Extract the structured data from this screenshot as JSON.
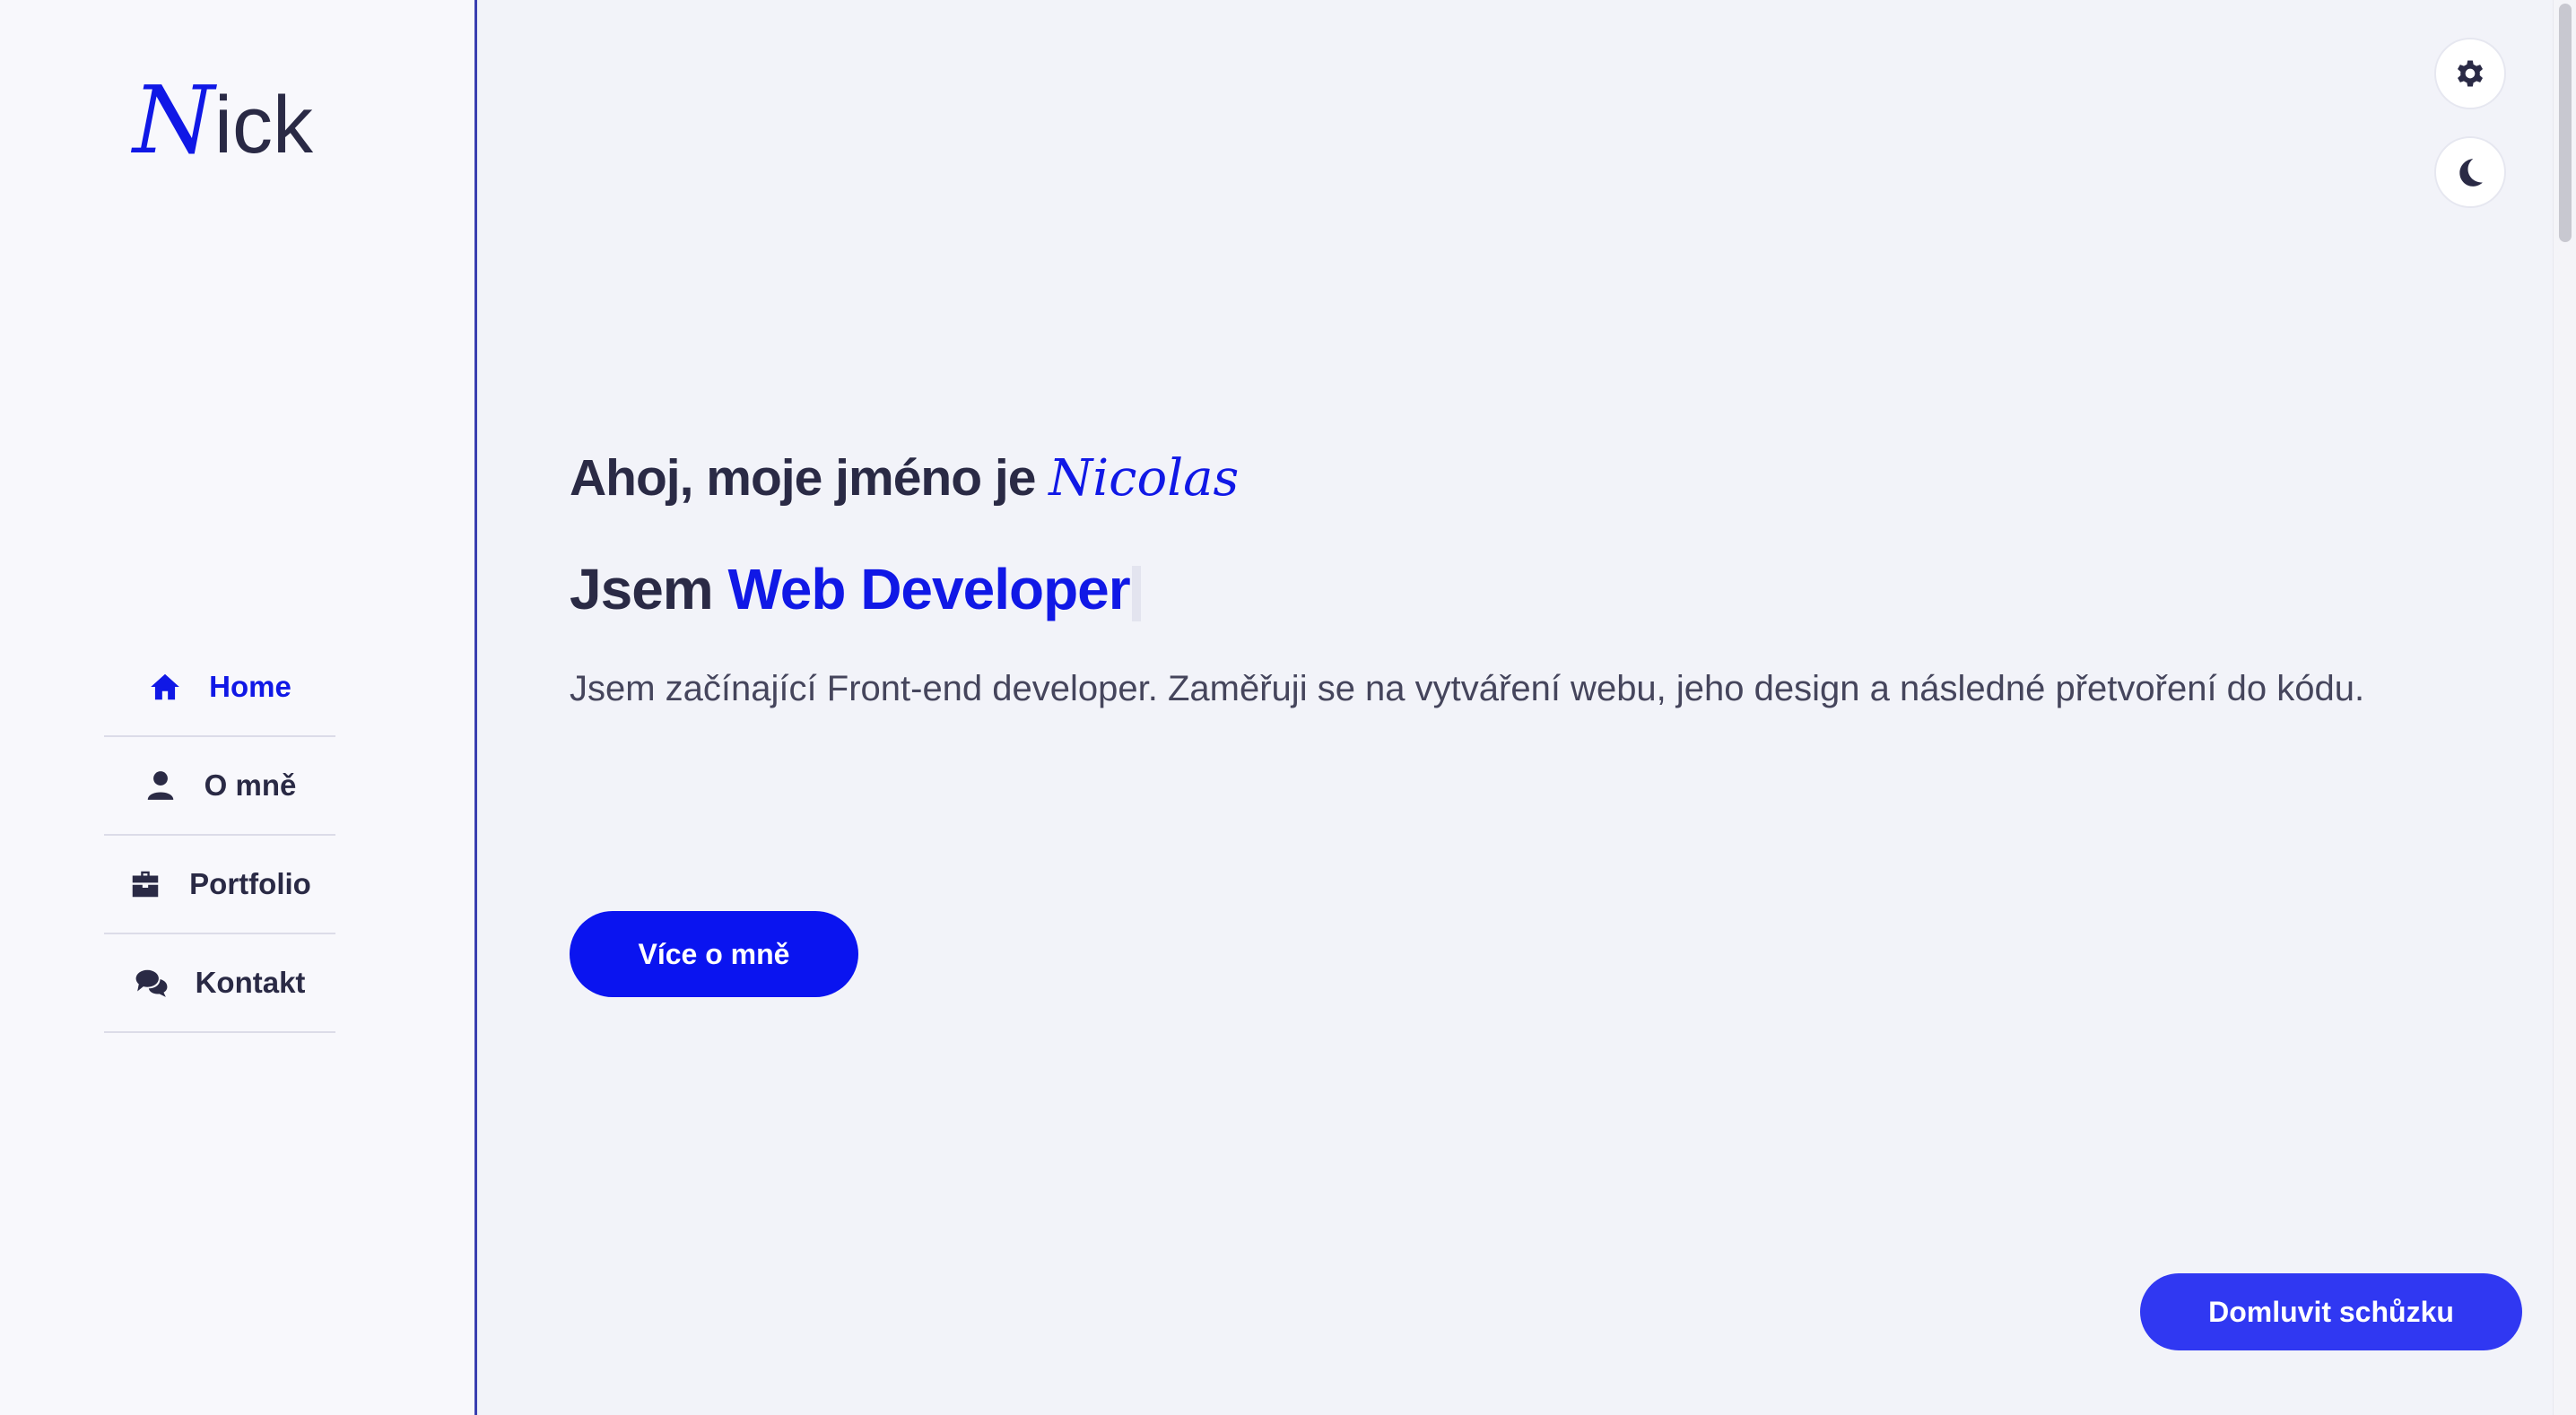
{
  "sidebar": {
    "logo_initial": "N",
    "logo_rest": "ick",
    "items": [
      {
        "label": "Home",
        "icon": "home-icon",
        "active": true
      },
      {
        "label": "O mně",
        "icon": "user-icon",
        "active": false
      },
      {
        "label": "Portfolio",
        "icon": "briefcase-icon",
        "active": false
      },
      {
        "label": "Kontakt",
        "icon": "comments-icon",
        "active": false
      }
    ]
  },
  "hero": {
    "greeting_prefix": "Ahoj, moje jméno je",
    "greeting_name": "Nicolas",
    "role_prefix": "Jsem",
    "role_accent": "Web Developer",
    "intro": "Jsem začínající Front-end developer. Zaměřuji se na vytváření webu, jeho design a následné přetvoření do kódu.",
    "more_button": "Více o mně"
  },
  "actions": {
    "settings_icon": "gear-icon",
    "theme_icon": "moon-icon",
    "meeting_button": "Domluvit schůzku"
  },
  "colors": {
    "accent": "#1018e6",
    "text": "#2a2a45",
    "background": "#f2f3f9"
  }
}
